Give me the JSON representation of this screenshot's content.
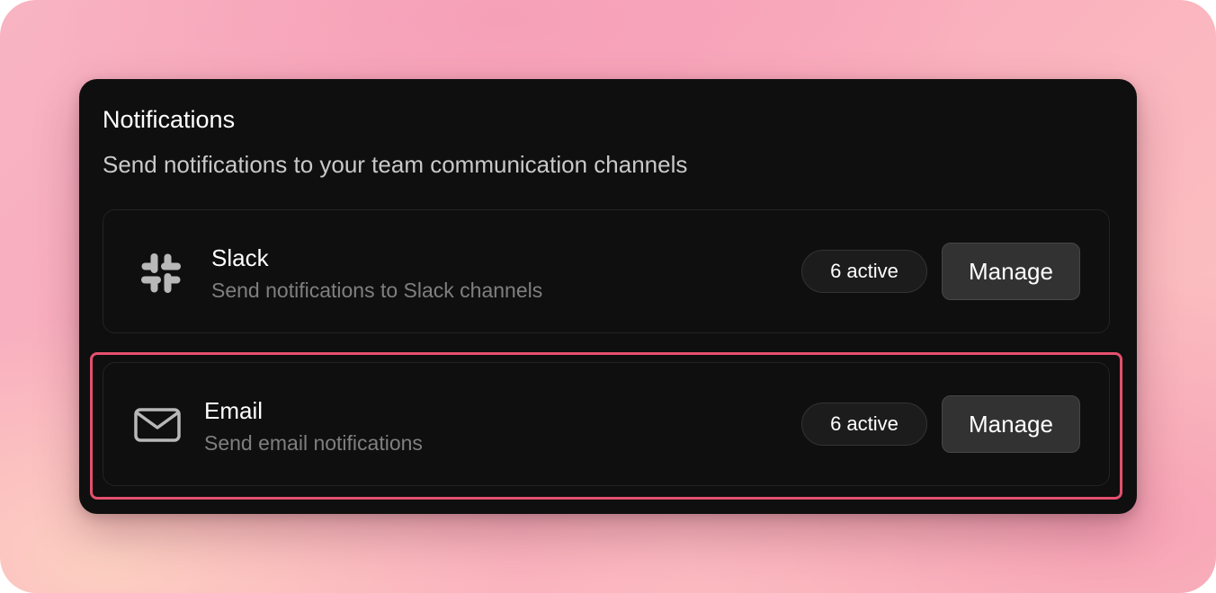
{
  "panel": {
    "title": "Notifications",
    "subtitle": "Send notifications to your team communication channels"
  },
  "integrations": [
    {
      "name": "Slack",
      "description": "Send notifications to Slack channels",
      "icon": "slack-icon",
      "badge": "6 active",
      "action_label": "Manage"
    },
    {
      "name": "Email",
      "description": "Send email notifications",
      "icon": "envelope-icon",
      "badge": "6 active",
      "action_label": "Manage"
    }
  ],
  "colors": {
    "panel_background": "#0f0f0f",
    "highlight": "#e4506e",
    "icon": "#b8b8b8",
    "button_background": "#323232"
  }
}
